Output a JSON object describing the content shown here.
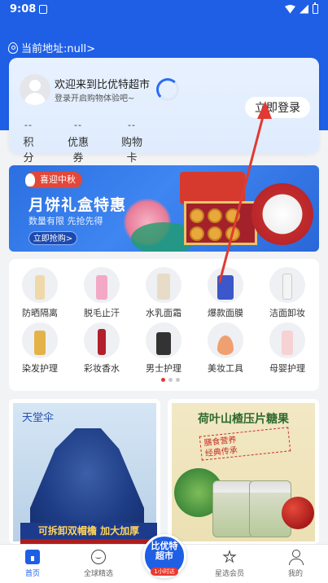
{
  "status_bar": {
    "time": "9:08"
  },
  "header": {
    "address": "当前地址:null>"
  },
  "user_card": {
    "welcome": "欢迎来到比优特超市",
    "subtitle": "登录开启购物体验吧~",
    "login_button": "立即登录",
    "stats": [
      {
        "value": "--",
        "label": "积分"
      },
      {
        "value": "--",
        "label": "优惠券"
      },
      {
        "value": "--",
        "label": "购物卡"
      }
    ]
  },
  "banner": {
    "tag": "喜迎中秋",
    "title": "月饼礼盒特惠",
    "subtitle": "数量有限 先抢先得",
    "button": "立即抢购>"
  },
  "categories": [
    {
      "label": "防晒隔离",
      "icon": "sunscreen-icon"
    },
    {
      "label": "脱毛止汗",
      "icon": "hair-removal-icon"
    },
    {
      "label": "水乳面霜",
      "icon": "lotion-icon"
    },
    {
      "label": "爆款面膜",
      "icon": "face-mask-icon"
    },
    {
      "label": "洁面卸妆",
      "icon": "cleanser-icon"
    },
    {
      "label": "染发护理",
      "icon": "hair-dye-icon"
    },
    {
      "label": "彩妆香水",
      "icon": "perfume-icon"
    },
    {
      "label": "男士护理",
      "icon": "men-care-icon"
    },
    {
      "label": "美妆工具",
      "icon": "makeup-tool-icon"
    },
    {
      "label": "母婴护理",
      "icon": "baby-care-icon"
    }
  ],
  "pager": {
    "pages": 3,
    "active": 1
  },
  "promos": {
    "left": {
      "brand": "天堂伞",
      "tagline": "可拆卸双帽檐 加大加厚"
    },
    "right": {
      "title": "荷叶山楂压片糖果",
      "slogan_1": "膳食营养",
      "slogan_2": "经典传承"
    }
  },
  "tabbar": {
    "tabs": [
      {
        "label": "首页",
        "icon": "home-icon",
        "active": true
      },
      {
        "label": "全球精选",
        "icon": "globe-icon",
        "active": false
      },
      {
        "label": "星选会员",
        "icon": "star-icon",
        "active": false
      },
      {
        "label": "我的",
        "icon": "user-icon",
        "active": false
      }
    ],
    "center": {
      "line1": "比优特",
      "line2": "超市",
      "badge": "1小时达"
    }
  },
  "colors": {
    "brand_blue": "#1f5fe6",
    "accent_red": "#e7392f",
    "arrow_red": "#e03a32"
  }
}
